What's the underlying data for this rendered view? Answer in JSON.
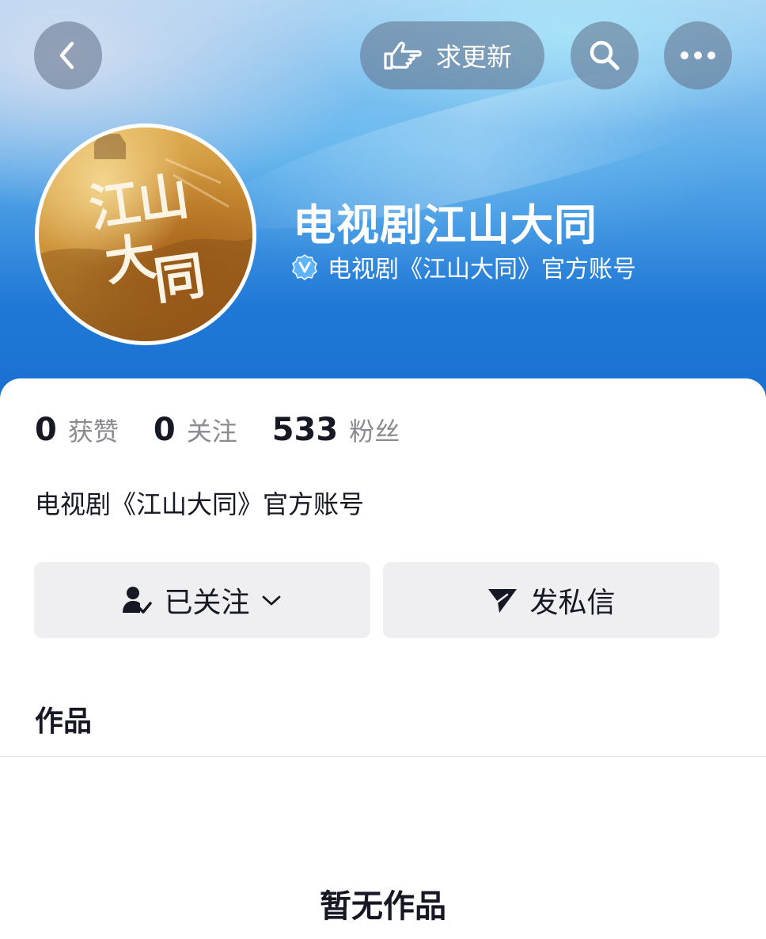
{
  "topbar": {
    "back_icon": "chevron-left-icon",
    "update_label": "求更新",
    "update_icon": "pointing-hand-icon",
    "search_icon": "search-icon",
    "more_icon": "more-horizontal-icon"
  },
  "profile": {
    "name": "电视剧江山大同",
    "verified_icon": "verified-v-icon",
    "verified_text": "电视剧《江山大同》官方账号",
    "avatar_text": "江山大同"
  },
  "stats": [
    {
      "value": "0",
      "label": "获赞"
    },
    {
      "value": "0",
      "label": "关注"
    },
    {
      "value": "533",
      "label": "粉丝"
    }
  ],
  "bio": "电视剧《江山大同》官方账号",
  "actions": {
    "follow_label": "已关注",
    "follow_icon": "user-check-icon",
    "dropdown_icon": "chevron-down-icon",
    "message_label": "发私信",
    "message_icon": "send-icon"
  },
  "works": {
    "title": "作品",
    "empty_text": "暂无作品"
  },
  "colors": {
    "header_blue": "#1f78d6",
    "text_primary": "#161823",
    "text_secondary": "#8a8b91",
    "button_bg": "#efeff1"
  }
}
